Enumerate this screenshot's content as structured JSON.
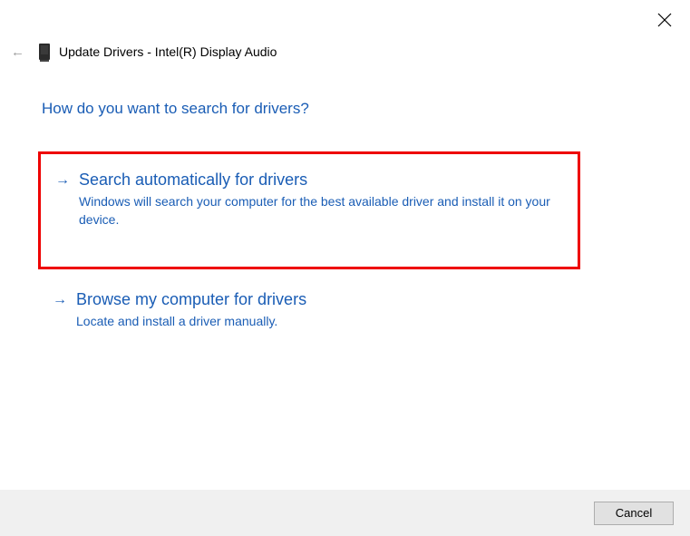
{
  "header": {
    "title": "Update Drivers - Intel(R) Display Audio"
  },
  "heading": "How do you want to search for drivers?",
  "options": [
    {
      "title": "Search automatically for drivers",
      "description": "Windows will search your computer for the best available driver and install it on your device.",
      "highlighted": true
    },
    {
      "title": "Browse my computer for drivers",
      "description": "Locate and install a driver manually.",
      "highlighted": false
    }
  ],
  "footer": {
    "cancel_label": "Cancel"
  }
}
